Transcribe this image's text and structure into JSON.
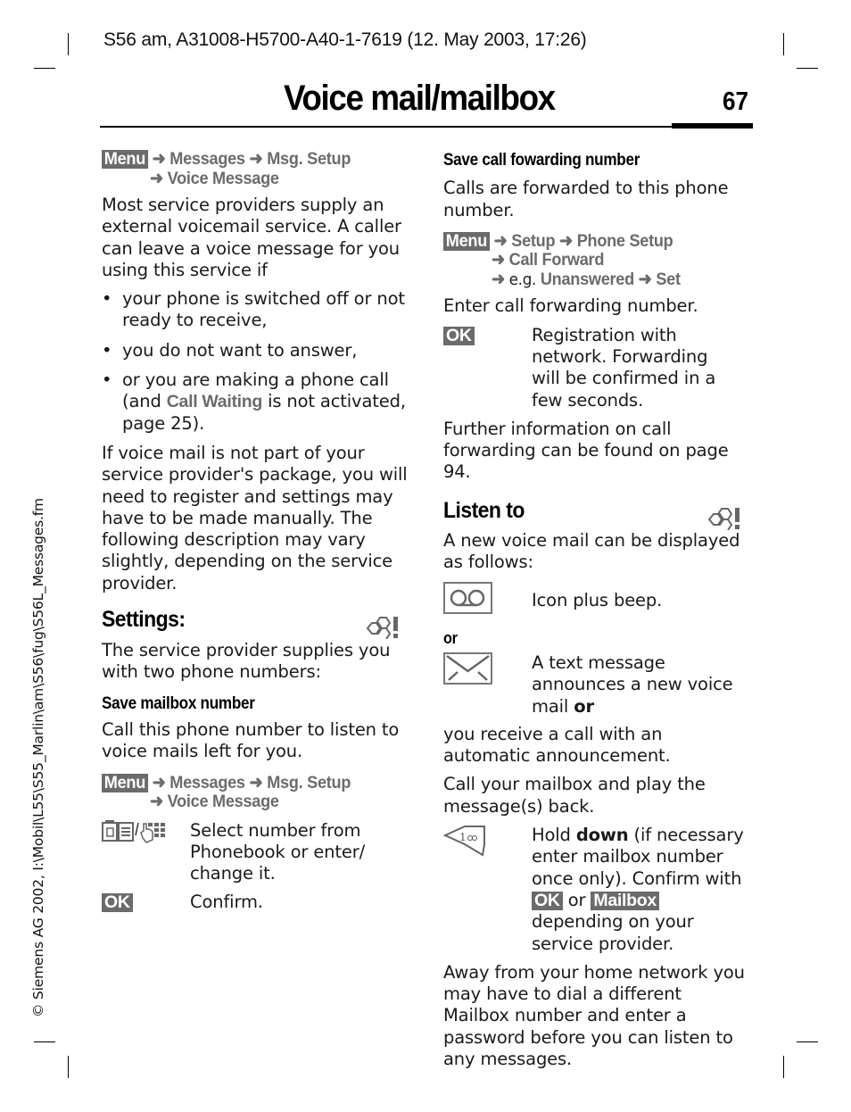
{
  "header": {
    "doc_ref": "S56 am, A31008-H5700-A40-1-7619 (12. May 2003, 17:26)",
    "title": "Voice mail/mailbox",
    "page_number": "67"
  },
  "side_text": "© Siemens AG 2002, I:\\Mobil\\L55\\S55_Marlin\\am\\S56\\fug\\S56L_Messages.fm",
  "left_column": {
    "path1": {
      "key": "Menu",
      "arrow": "➜",
      "step1": "Messages",
      "step2": "Msg. Setup",
      "step3": "Voice Message"
    },
    "intro": "Most service providers supply an external voicemail service. A caller can leave a voice message for you using this service if",
    "bullets": [
      "your phone is switched off or not ready to receive,",
      "you do not want to answer,"
    ],
    "bullet3": {
      "before": "or you are making a phone call (and ",
      "ui": "Call Waiting",
      "after": " is not activated, page 25)."
    },
    "not_part": "If voice mail is not part of your service provider's package, you will need to register and settings may have to be made manually. The following description may vary slightly, depending on the service provider.",
    "settings_heading": "Settings:",
    "settings_text": "The service provider supplies you with two phone numbers:",
    "save_mailbox_heading": "Save mailbox number",
    "save_mailbox_text": "Call this phone number to listen to voice mails left for you.",
    "path2": {
      "key": "Menu",
      "arrow": "➜",
      "step1": "Messages",
      "step2": "Msg. Setup",
      "step3": "Voice Message"
    },
    "select_text": "Select number from Phonebook or enter/ change it.",
    "ok_key": "OK",
    "confirm_text": "Confirm."
  },
  "right_column": {
    "forward_heading": "Save call fowarding number",
    "forward_text": "Calls are forwarded to this phone number.",
    "path3": {
      "key": "Menu",
      "arrow": "➜",
      "step1": "Setup",
      "step2": "Phone Setup",
      "step3": "Call Forward",
      "eg": "e.g.",
      "step4": "Unanswered",
      "step5": "Set"
    },
    "enter_text": "Enter call forwarding number.",
    "ok_key": "OK",
    "registration_text": "Registration with network. Forwarding will be confirmed in a few seconds.",
    "further_text": "Further information on call forwarding can be found on page 94.",
    "listen_heading": "Listen to",
    "listen_text": "A new voice mail can be displayed as follows:",
    "icon_beep_text": "Icon plus beep.",
    "or_label": "or",
    "text_msg_before": "A text message announces a new voice mail ",
    "text_msg_bold": "or",
    "receive_text": "you receive a call with an automatic announcement.",
    "call_mailbox_text": "Call your mailbox and play the message(s) back.",
    "hold_before": "Hold ",
    "hold_bold": "down",
    "hold_after": " (if necessary enter mailbox number once only). Confirm with ",
    "hold_ok": "OK",
    "hold_or": " or ",
    "hold_mailbox": "Mailbox",
    "hold_end": " depending on your service provider.",
    "away_text": "Away from your home network you may have to dial a different Mailbox number and enter a password before you can listen to any messages."
  }
}
